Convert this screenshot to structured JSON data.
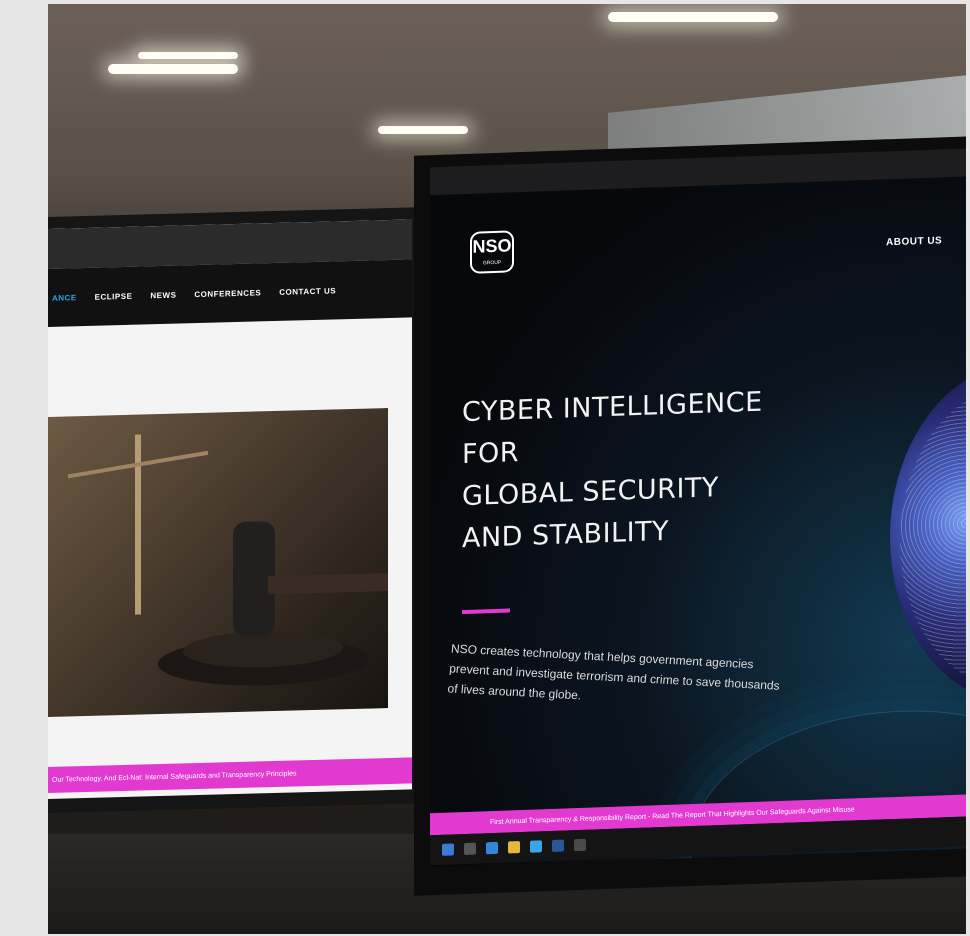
{
  "left_screen": {
    "nav_items": [
      {
        "label": "ANCE",
        "active": true
      },
      {
        "label": "ECLIPSE",
        "active": false
      },
      {
        "label": "NEWS",
        "active": false
      },
      {
        "label": "CONFERENCES",
        "active": false
      },
      {
        "label": "CONTACT US",
        "active": false
      }
    ],
    "footer_text": "Our Technology. And Ecl-Nat: Internal Safeguards and Transparency Principles"
  },
  "right_screen": {
    "about_label": "ABOUT US",
    "logo_text": "NSO",
    "logo_sub": "GROUP",
    "headline_lines": [
      "CYBER INTELLIGENCE",
      "FOR",
      "GLOBAL SECURITY",
      "AND STABILITY"
    ],
    "body_text": "NSO creates technology that helps government agencies prevent and investigate terrorism and crime to save thousands of lives around the globe.",
    "footer_text": "First Annual Transparency & Responsibility Report - Read The Report That Highlights Our Safeguards Against Misuse"
  },
  "colors": {
    "accent": "#e23ad0",
    "link_blue": "#29a9e1"
  }
}
